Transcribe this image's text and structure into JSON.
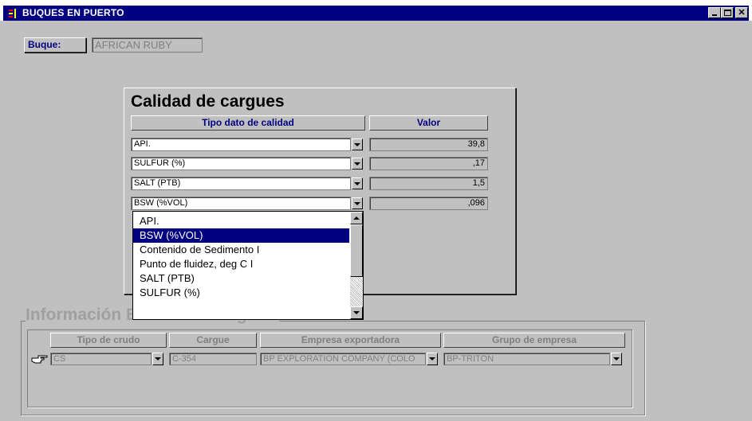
{
  "window": {
    "title": "BUQUES EN PUERTO",
    "controls": [
      "minimize",
      "maximize",
      "close"
    ]
  },
  "buque": {
    "label": "Buque:",
    "value": "AFRICAN RUBY"
  },
  "calidad": {
    "title": "Calidad de cargues",
    "col_tipo": "Tipo dato de calidad",
    "col_valor": "Valor",
    "rows": [
      {
        "tipo": "API.",
        "valor": "39,8"
      },
      {
        "tipo": "SULFUR (%)",
        "valor": ",17"
      },
      {
        "tipo": "SALT (PTB)",
        "valor": "1,5"
      },
      {
        "tipo": "BSW  (%VOL)",
        "valor": ",096"
      }
    ],
    "dropdown": {
      "items": [
        "API.",
        "BSW  (%VOL)",
        "Contenido de Sedimento I",
        "Punto de fluidez, deg C I",
        "SALT (PTB)",
        "SULFUR (%)"
      ],
      "selected_index": 1
    }
  },
  "info": {
    "title": "Información Básica de Cargues",
    "col_crudo": "Tipo de crudo",
    "col_cargue": "Cargue",
    "col_empresa": "Empresa exportadora",
    "col_grupo": "Grupo de empresa",
    "row": {
      "crudo": "CS",
      "cargue": "C-354",
      "empresa": "BP EXPLORATION COMPANY (COLO",
      "grupo": "BP-TRITON"
    }
  },
  "colors": {
    "titlebar": "#000080",
    "face": "#c0c0c0",
    "selection": "#000080",
    "header_text": "#000080",
    "disabled_text": "#808080"
  }
}
